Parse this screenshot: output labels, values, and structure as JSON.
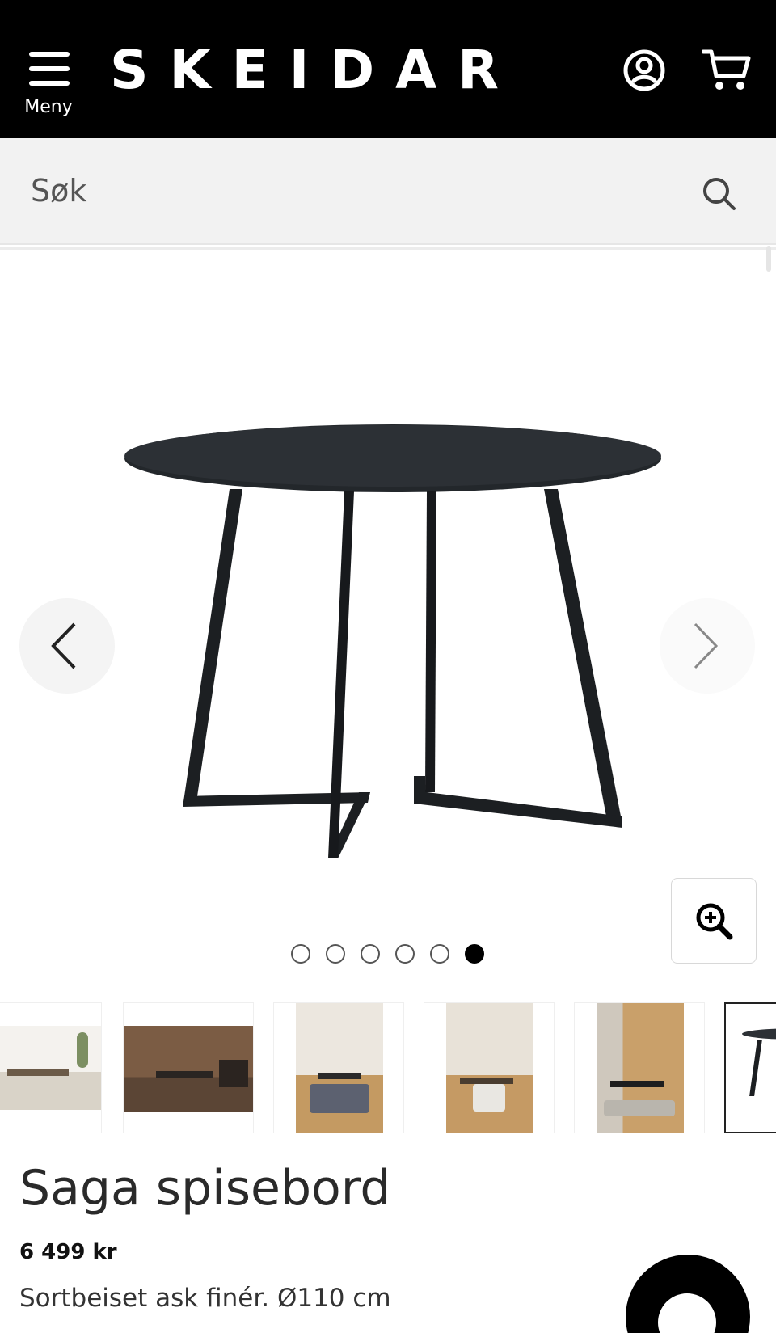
{
  "header": {
    "menu_label": "Meny",
    "brand": "SKEIDAR",
    "icons": [
      "hamburger-menu-icon",
      "user-account-icon",
      "shopping-cart-icon"
    ]
  },
  "search": {
    "placeholder": "Søk",
    "icon": "search-icon"
  },
  "carousel": {
    "image_count": 6,
    "active_index": 6,
    "prev_icon": "chevron-left-icon",
    "next_icon": "chevron-right-icon",
    "zoom_icon": "zoom-in-icon"
  },
  "thumbnails": {
    "count": 6,
    "active_index": 6
  },
  "product": {
    "title": "Saga spisebord",
    "price": "6 499 kr",
    "description": "Sortbeiset ask finér. Ø110 cm"
  },
  "colors": {
    "header_bg": "#000000",
    "search_bg": "#f2f2f2",
    "table_color": "#1f2327"
  }
}
